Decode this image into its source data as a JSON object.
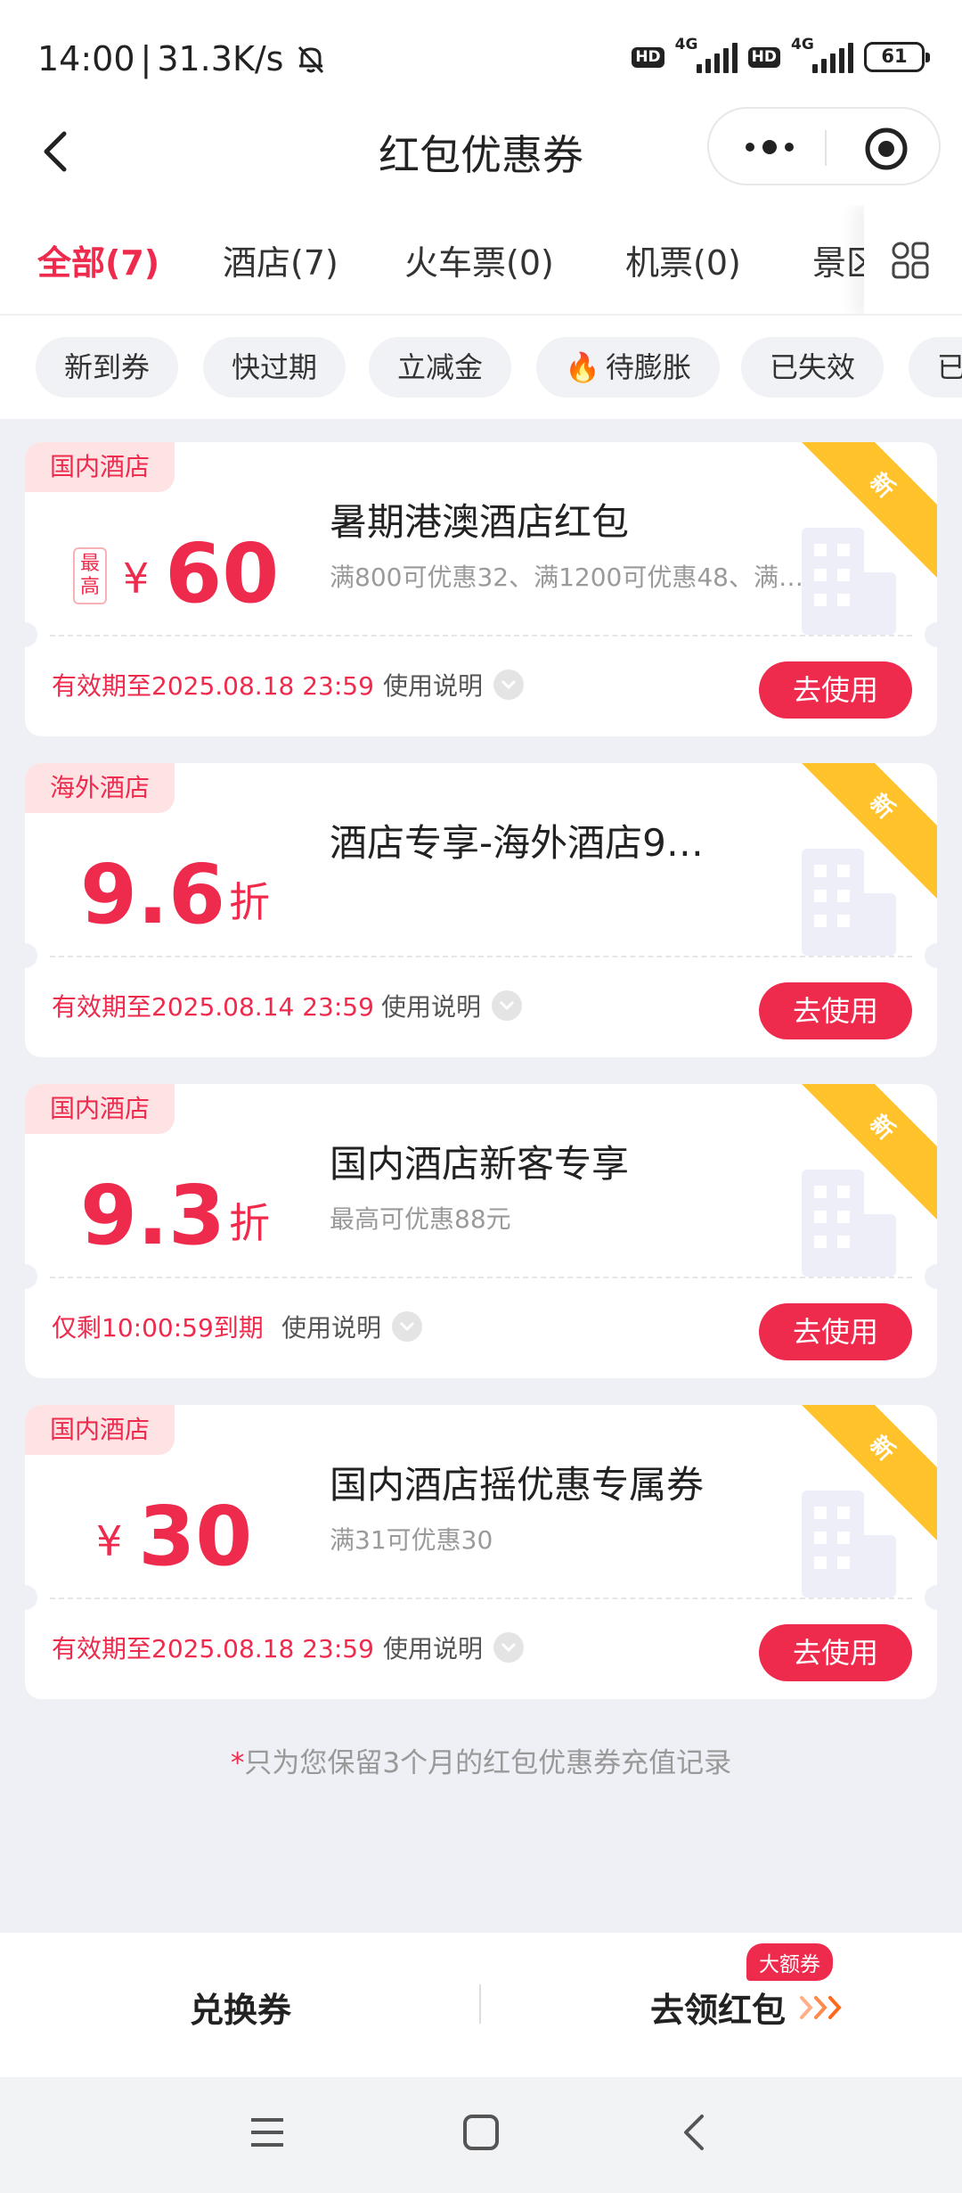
{
  "status_bar": {
    "time": "14:00",
    "speed": "31.3K/s",
    "hd": "HD",
    "net1": "4G",
    "net2": "4G",
    "battery": "61"
  },
  "nav": {
    "title": "红包优惠券"
  },
  "tabs": [
    {
      "label": "全部(7)",
      "active": true
    },
    {
      "label": "酒店(7)",
      "active": false
    },
    {
      "label": "火车票(0)",
      "active": false
    },
    {
      "label": "机票(0)",
      "active": false
    },
    {
      "label": "景区",
      "active": false
    }
  ],
  "chips": [
    {
      "label": "新到券"
    },
    {
      "label": "快过期"
    },
    {
      "label": "立减金"
    },
    {
      "label": "待膨胀",
      "icon": "fire-icon"
    },
    {
      "label": "已失效"
    },
    {
      "label": "已"
    }
  ],
  "coupons": [
    {
      "tag": "国内酒店",
      "max_tag": "最高",
      "currency": "¥",
      "amount": "60",
      "title": "暑期港澳酒店红包",
      "desc": "满800可优惠32、满1200可优惠48、满…",
      "expiry": "有效期至2025.08.18 23:59",
      "usage": "使用说明",
      "button": "去使用",
      "ribbon": "新"
    },
    {
      "tag": "海外酒店",
      "amount": "9.6",
      "discount_unit": "折",
      "title": "酒店专享-海外酒店9…",
      "desc": "",
      "expiry": "有效期至2025.08.14 23:59",
      "usage": "使用说明",
      "button": "去使用",
      "ribbon": "新"
    },
    {
      "tag": "国内酒店",
      "amount": "9.3",
      "discount_unit": "折",
      "title": "国内酒店新客专享",
      "desc": "最高可优惠88元",
      "expiry": "仅剩10:00:59到期",
      "usage": "使用说明",
      "button": "去使用",
      "ribbon": "新"
    },
    {
      "tag": "国内酒店",
      "currency": "¥",
      "amount": "30",
      "title": "国内酒店摇优惠专属券",
      "desc": "满31可优惠30",
      "expiry": "有效期至2025.08.18 23:59",
      "usage": "使用说明",
      "button": "去使用",
      "ribbon": "新"
    }
  ],
  "footnote": {
    "star": "*",
    "text": "只为您保留3个月的红包优惠券充值记录"
  },
  "bottom_bar": {
    "exchange": "兑换券",
    "get_red_packet": "去领红包",
    "badge": "大额券"
  },
  "colors": {
    "accent": "#ee2a4d",
    "ribbon": "#ffc22a",
    "tag_bg": "#fde3e4"
  }
}
